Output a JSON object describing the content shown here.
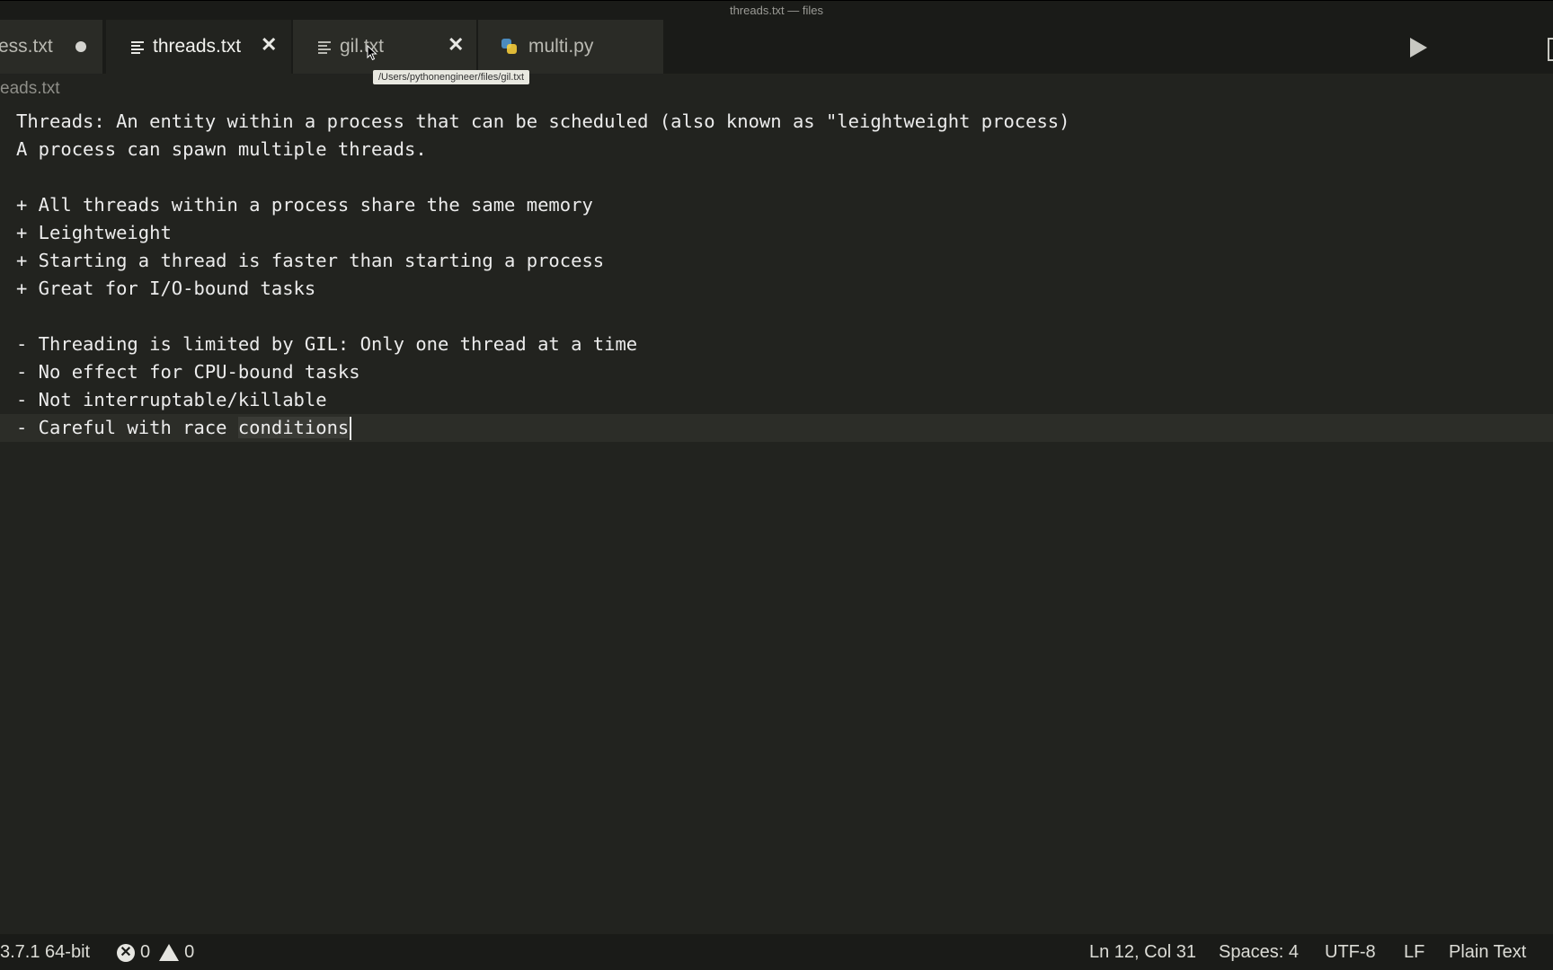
{
  "window": {
    "title": "threads.txt — files"
  },
  "tabs": [
    {
      "label": "ess.txt",
      "state": "modified",
      "icon": "text-file-icon"
    },
    {
      "label": "threads.txt",
      "state": "active",
      "icon": "text-file-icon"
    },
    {
      "label": "gil.txt",
      "state": "hover",
      "icon": "text-file-icon"
    },
    {
      "label": "multi.py",
      "state": "normal",
      "icon": "python-icon"
    }
  ],
  "tooltip": {
    "text": "/Users/pythonengineer/files/gil.txt"
  },
  "breadcrumb": {
    "text": "eads.txt"
  },
  "editor": {
    "lines": [
      "Threads: An entity within a process that can be scheduled (also known as \"leightweight process)",
      "A process can spawn multiple threads.",
      "",
      "+ All threads within a process share the same memory",
      "+ Leightweight",
      "+ Starting a thread is faster than starting a process",
      "+ Great for I/O-bound tasks",
      "",
      "- Threading is limited by GIL: Only one thread at a time",
      "- No effect for CPU-bound tasks",
      "- Not interruptable/killable"
    ],
    "current_line_prefix": "- Careful with race ",
    "current_line_selected": "conditions"
  },
  "statusbar": {
    "interpreter": "3.7.1 64-bit",
    "errors": "0",
    "warnings": "0",
    "position": "Ln 12, Col 31",
    "spaces": "Spaces: 4",
    "encoding": "UTF-8",
    "eol": "LF",
    "language": "Plain Text"
  },
  "colors": {
    "background": "#22231f",
    "tabbar": "#1a1b18",
    "python_blue": "#4b8bbe",
    "python_yellow": "#ffd43b"
  }
}
